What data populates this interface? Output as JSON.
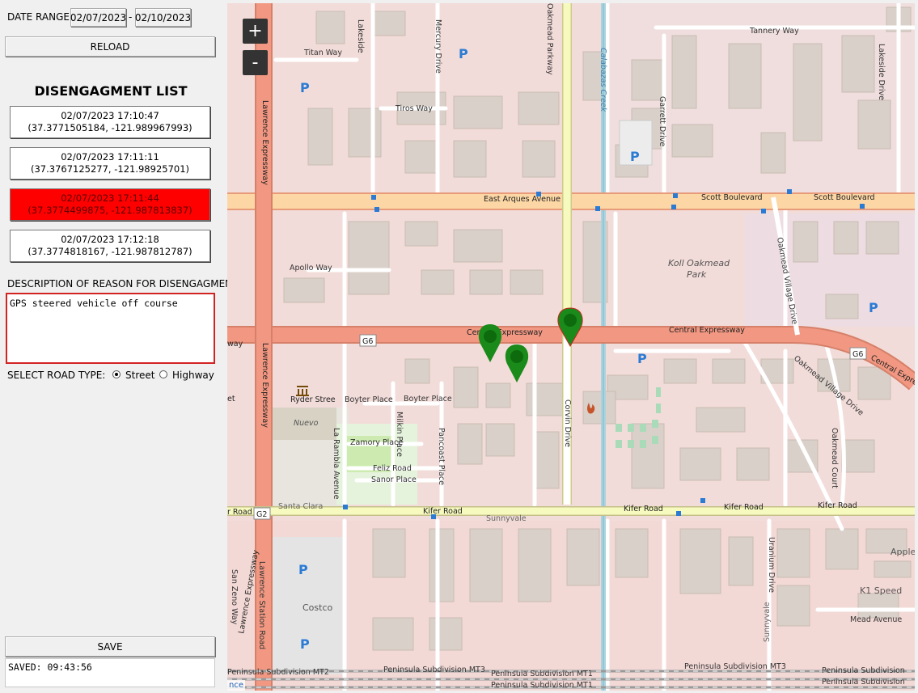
{
  "filter": {
    "date_range_label": "DATE RANGE:",
    "start_date": "02/07/2023",
    "separator": "-",
    "end_date": "02/10/2023",
    "reload_label": "RELOAD"
  },
  "list": {
    "title": "DISENGAGMENT LIST",
    "items": [
      {
        "time": "02/07/2023 17:10:47",
        "coords": "(37.3771505184, -121.989967993)",
        "selected": false
      },
      {
        "time": "02/07/2023 17:11:11",
        "coords": "(37.3767125277, -121.98925701)",
        "selected": false
      },
      {
        "time": "02/07/2023 17:11:44",
        "coords": "(37.3774499875, -121.987813837)",
        "selected": true
      },
      {
        "time": "02/07/2023 17:12:18",
        "coords": "(37.3774818167, -121.987812787)",
        "selected": false
      }
    ]
  },
  "description": {
    "label": "DESCRIPTION OF REASON FOR DISENGAGMENT",
    "value": "GPS steered vehicle off course"
  },
  "road_type": {
    "label": "SELECT ROAD TYPE:",
    "options": [
      "Street",
      "Highway"
    ],
    "selected": "Street"
  },
  "save": {
    "label": "SAVE",
    "status": "SAVED: 09:43:56"
  },
  "map": {
    "zoom_in": "+",
    "zoom_out": "-",
    "attribution": "nce",
    "marker_color": "#1a8a1a",
    "labels": {
      "titan_way": "Titan Way",
      "tiros_way": "Tiros Way",
      "lakeside": "Lakeside",
      "mercury_drive": "Mercury Drive",
      "oakmead_parkway": "Oakmead Parkway",
      "calabazas_creek": "Calabazas Creek",
      "garrett_drive": "Garrett Drive",
      "tannery_way": "Tannery Way",
      "lakeside_drive": "Lakeside Drive",
      "east_arques": "East Arques Avenue",
      "scott_blvd_1": "Scott Boulevard",
      "scott_blvd_2": "Scott Boulevard",
      "koll_oakmead": "Koll Oakmead",
      "park": "Park",
      "apollo_way": "Apollo Way",
      "lawrence_expy_1": "Lawrence Expressway",
      "lawrence_expy_2": "Lawrence Expressway",
      "lawrence_expy_3": "Lawrence Expressway",
      "central_expy_1": "Central Expressway",
      "central_expy_2": "Central Expressway",
      "central_expy_3": "Central Expressway",
      "way": "way",
      "g6_1": "G6",
      "g6_2": "G6",
      "g2": "G2",
      "oakmead_village_1": "Oakmead Village Drive",
      "oakmead_village_2": "Oakmead Village Drive",
      "ryder_street": "Ryder Stree",
      "boyter_place_1": "Boyter Place",
      "boyter_place_2": "Boyter Place",
      "nuevo": "Nuevo",
      "la_rambla": "La Rambla Avenue",
      "milkin_place": "Milkin Place",
      "pancoast_place": "Pancoast Place",
      "zamory_place": "Zamory Place",
      "feliz_road": "Feliz Road",
      "sanor_place": "Sanor Place",
      "corvin_drive": "Corvin Drive",
      "santa_clara": "Santa Clara",
      "sunnyvale_1": "Sunnyvale",
      "sunnyvale_2": "Sunnyvale",
      "kifer_road_1": "r Road",
      "kifer_road_2": "Kifer Road",
      "kifer_road_3": "Kifer Road",
      "kifer_road_4": "Kifer Road",
      "kifer_road_5": "Kifer Road",
      "oakmead_court": "Oakmead Court",
      "uranium_drive": "Uranium Drive",
      "lawrence_station": "Lawrence Station Road",
      "san_zeno": "San Zeno Way",
      "costco": "Costco",
      "apple": "Apple",
      "k1_speed": "K1 Speed",
      "mead_avenue": "Mead Avenue",
      "rail_1": "Peninsula Subdivision MT2",
      "rail_2": "Peninsula Subdivision MT3",
      "rail_3": "Peninsula Subdivision MT1",
      "rail_4": "Peninsula Subdivision MT1",
      "rail_5": "Peninsula Subdivision MT3",
      "rail_6": "Peninsula Subdivision",
      "rail_7": "Peninsula Subdivision",
      "parking": "P",
      "et": "et"
    }
  }
}
